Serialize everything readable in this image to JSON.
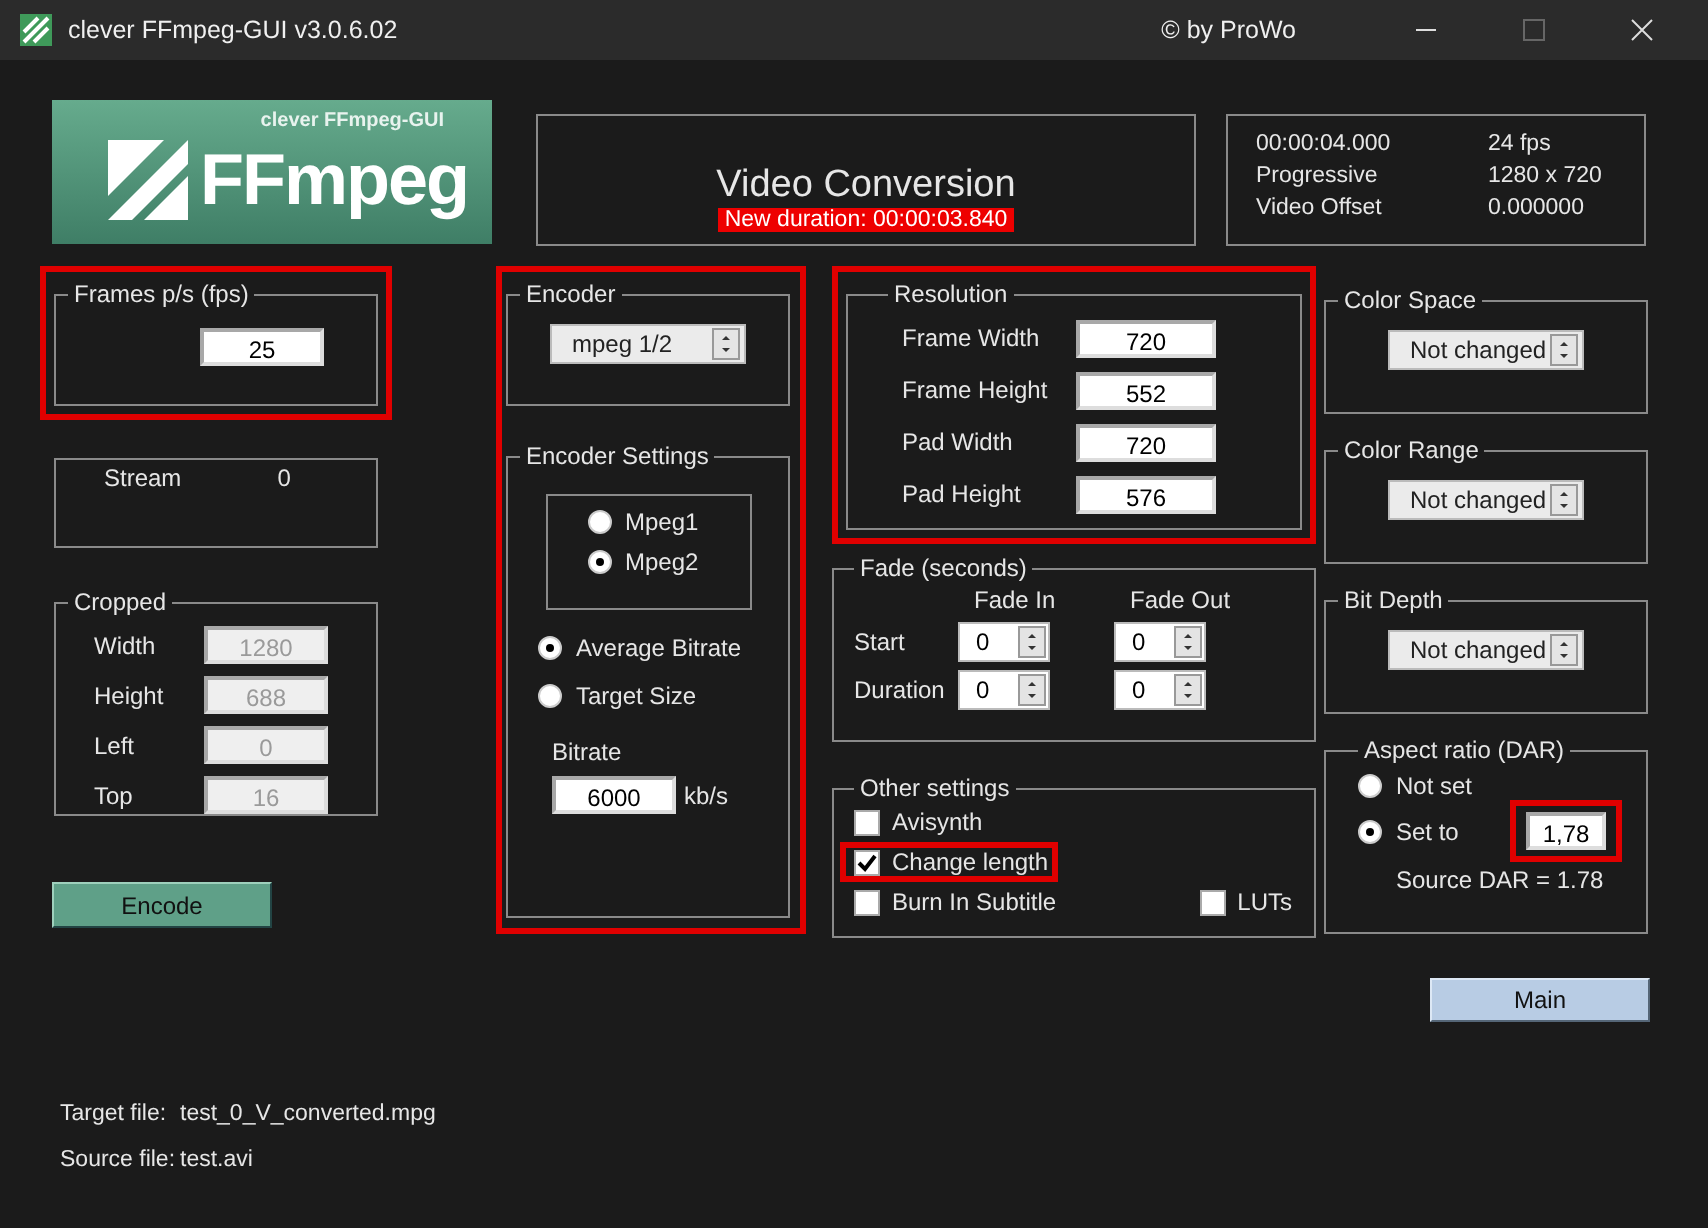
{
  "window": {
    "title": "clever FFmpeg-GUI v3.0.6.02",
    "copyright": "© by ProWo"
  },
  "logo": {
    "caption": "clever FFmpeg-GUI",
    "wordmark": "FFmpeg"
  },
  "header": {
    "title": "Video Conversion",
    "new_duration": "New duration: 00:00:03.840"
  },
  "source_info": [
    {
      "label": "00:00:04.000",
      "value": "24 fps"
    },
    {
      "label": "Progressive",
      "value": "1280 x 720"
    },
    {
      "label": "Video Offset",
      "value": "0.000000"
    }
  ],
  "fps": {
    "title": "Frames p/s (fps)",
    "value": "25",
    "highlighted": true
  },
  "stream": {
    "label": "Stream",
    "value": "0"
  },
  "cropped": {
    "title": "Cropped",
    "fields": [
      {
        "label": "Width",
        "value": "1280",
        "disabled": true
      },
      {
        "label": "Height",
        "value": "688",
        "disabled": true
      },
      {
        "label": "Left",
        "value": "0",
        "disabled": true
      },
      {
        "label": "Top",
        "value": "16",
        "disabled": true
      }
    ]
  },
  "encode_button": "Encode",
  "encoder_panel": {
    "highlighted": true,
    "encoder": {
      "title": "Encoder",
      "value": "mpeg 1/2"
    },
    "settings": {
      "title": "Encoder Settings",
      "formats": [
        {
          "label": "Mpeg1",
          "selected": false
        },
        {
          "label": "Mpeg2",
          "selected": true
        }
      ],
      "modes": [
        {
          "label": "Average Bitrate",
          "selected": true
        },
        {
          "label": "Target Size",
          "selected": false
        }
      ],
      "bitrate_label": "Bitrate",
      "bitrate": "6000",
      "unit": "kb/s"
    }
  },
  "resolution": {
    "title": "Resolution",
    "highlighted": true,
    "fields": [
      {
        "label": "Frame Width",
        "value": "720"
      },
      {
        "label": "Frame Height",
        "value": "552"
      },
      {
        "label": "Pad Width",
        "value": "720"
      },
      {
        "label": "Pad Height",
        "value": "576"
      }
    ]
  },
  "fade": {
    "title": "Fade (seconds)",
    "columns": [
      "Fade In",
      "Fade Out"
    ],
    "rows": [
      {
        "label": "Start",
        "values": [
          "0",
          "0"
        ]
      },
      {
        "label": "Duration",
        "values": [
          "0",
          "0"
        ]
      }
    ]
  },
  "other_settings": {
    "title": "Other settings",
    "options": [
      {
        "label": "Avisynth",
        "checked": false,
        "highlighted": false
      },
      {
        "label": "Change length",
        "checked": true,
        "highlighted": true
      },
      {
        "label": "Burn In Subtitle",
        "checked": false,
        "highlighted": false
      },
      {
        "label": "LUTs",
        "checked": false,
        "highlighted": false
      }
    ]
  },
  "dropdowns": [
    {
      "title": "Color Space",
      "value": "Not changed"
    },
    {
      "title": "Color Range",
      "value": "Not changed"
    },
    {
      "title": "Bit Depth",
      "value": "Not changed"
    }
  ],
  "aspect": {
    "title": "Aspect ratio (DAR)",
    "options": [
      {
        "label": "Not set",
        "selected": false
      },
      {
        "label": "Set to",
        "selected": true
      }
    ],
    "value": "1,78",
    "value_highlighted": true,
    "source": "Source DAR = 1.78"
  },
  "main_button": "Main",
  "files": [
    {
      "label": "Target file:",
      "value": "test_0_V_converted.mpg"
    },
    {
      "label": "Source file:",
      "value": "test.avi"
    }
  ]
}
